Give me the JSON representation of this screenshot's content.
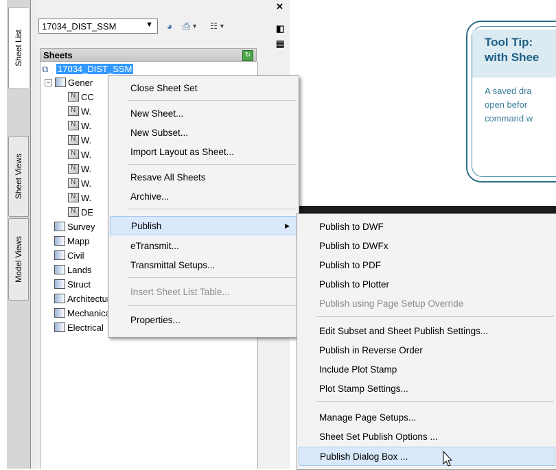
{
  "palette": {
    "side_tabs": [
      "Sheet List",
      "Sheet Views",
      "Model Views"
    ],
    "sheet_set_name": "17034_DIST_SSM",
    "sheets_header": "Sheets",
    "tree": {
      "root": "17034_DIST_SSM",
      "first_subset": "Gener",
      "sheets": [
        "CC",
        "W.",
        "W.",
        "W.",
        "W.",
        "W.",
        "W.",
        "W.",
        "DE"
      ],
      "subsets": [
        "Survey",
        "Mapp",
        "Civil",
        "Lands",
        "Struct",
        "Architectural",
        "Mechanical",
        "Electrical"
      ]
    }
  },
  "context_menu": {
    "items": [
      {
        "label": "Close Sheet Set"
      },
      {
        "label": "New Sheet..."
      },
      {
        "label": "New Subset..."
      },
      {
        "label": "Import Layout as Sheet..."
      },
      {
        "label": "Resave All Sheets"
      },
      {
        "label": "Archive..."
      },
      {
        "label": "Publish"
      },
      {
        "label": "eTransmit..."
      },
      {
        "label": "Transmittal Setups..."
      },
      {
        "label": "Insert Sheet List Table..."
      },
      {
        "label": "Properties..."
      }
    ]
  },
  "publish_submenu": {
    "items": [
      {
        "label": "Publish to DWF"
      },
      {
        "label": "Publish to DWFx"
      },
      {
        "label": "Publish to PDF"
      },
      {
        "label": "Publish to Plotter"
      },
      {
        "label": "Publish using Page Setup Override"
      },
      {
        "label": "Edit Subset and Sheet Publish Settings..."
      },
      {
        "label": "Publish in Reverse Order"
      },
      {
        "label": "Include Plot Stamp"
      },
      {
        "label": "Plot Stamp Settings..."
      },
      {
        "label": "Manage Page Setups..."
      },
      {
        "label": "Sheet Set Publish Options ..."
      },
      {
        "label": "Publish Dialog Box ..."
      }
    ]
  },
  "tooltip": {
    "title_line1": "Tool Tip:",
    "title_line2": "with Shee",
    "body_line1": "A saved dra",
    "body_line2": "open befor",
    "body_line3": "command w"
  },
  "colors": {
    "selection": "#3399ff",
    "tooltip_accent": "#1b5e86",
    "menu_highlight": "#d9e8fb"
  }
}
